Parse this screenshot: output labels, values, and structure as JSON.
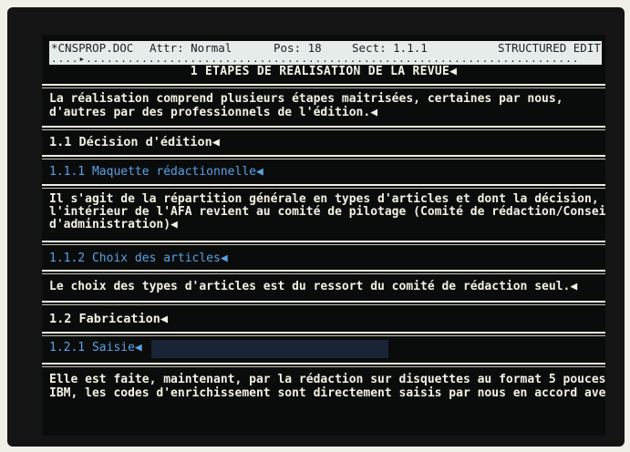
{
  "status": {
    "file": "*CNSPROP.DOC",
    "attr": "Attr: Normal",
    "pos": "Pos: 18",
    "sect": "Sect: 1.1.1",
    "mode": "STRUCTURED EDIT",
    "ruler": "....▸......................................................................."
  },
  "document": {
    "chapter_title": "1 ETAPES DE REALISATION DE LA REVUE◀",
    "intro_lines": [
      "La réalisation comprend plusieurs étapes maitrisées, certaines par nous,",
      "d'autres par des professionnels de l'édition.◀"
    ],
    "section_1_1": "1.1 Décision d'édition◀",
    "section_1_1_1": "1.1.1 Maquette rédactionnelle◀",
    "para_1_1_1_lines": [
      "Il s'agit de la répartition générale en types d'articles et dont la décision, à",
      "l'intérieur de l'AFA revient au comité de pilotage (Comité de rédaction/Conseil",
      "d'administration)◀"
    ],
    "section_1_1_2": "1.1.2 Choix des articles◀",
    "para_1_1_2": "Le choix des types d'articles est du ressort du comité de rédaction seul.◀",
    "section_1_2": "1.2 Fabrication◀",
    "section_1_2_1": "1.2.1 Saisie◀",
    "para_1_2_1_lines": [
      "Elle est faite, maintenant, par la rédaction sur disquettes au format 5 pouces",
      "IBM, les codes d'enrichissement sont directement saisis par nous en accord avec"
    ]
  }
}
